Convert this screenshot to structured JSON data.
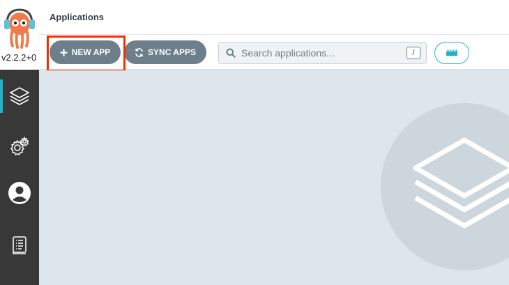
{
  "app": {
    "version": "v2.2.2+0",
    "logo_icon": "argo-octopus-logo",
    "accent_color": "#21b2c9"
  },
  "sidebar": {
    "items": [
      {
        "name": "applications",
        "icon": "layers-icon",
        "active": true
      },
      {
        "name": "settings",
        "icon": "gear-icon",
        "active": false
      },
      {
        "name": "user-info",
        "icon": "user-icon",
        "active": false
      },
      {
        "name": "documentation",
        "icon": "docs-icon",
        "active": false
      }
    ]
  },
  "header": {
    "title": "Applications"
  },
  "toolbar": {
    "new_app_label": "NEW APP",
    "sync_apps_label": "SYNC APPS",
    "search_placeholder": "Search applications...",
    "search_shortcut": "/",
    "highlight_color": "#ff2a00"
  }
}
